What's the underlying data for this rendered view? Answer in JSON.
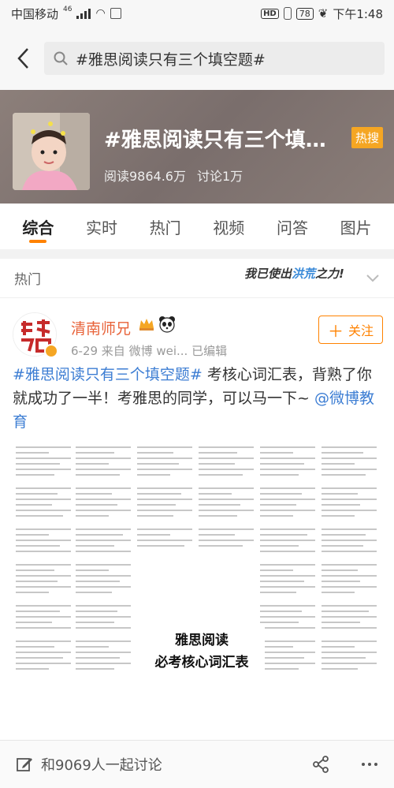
{
  "status": {
    "carrier": "中国移动",
    "net": "46",
    "hd": "HD",
    "battery": "78",
    "time": "下午1:48"
  },
  "search": {
    "query": "#雅思阅读只有三个填空题#"
  },
  "banner": {
    "title": "#雅思阅读只有三个填空题#",
    "hot_badge": "热搜",
    "reads": "阅读9864.6万",
    "discussions": "讨论1万"
  },
  "tabs": [
    "综合",
    "实时",
    "热门",
    "视频",
    "问答",
    "图片"
  ],
  "section": {
    "title": "热门",
    "sticker_pre": "我已使出",
    "sticker_mid": "洪荒",
    "sticker_post": "之力!"
  },
  "post": {
    "author": "清南师兄",
    "meta": "6-29  来自 微博 wei...  已编辑",
    "follow_label": "关注",
    "hashtag": "#雅思阅读只有三个填空题#",
    "text_body": " 考核心词汇表，背熟了你就成功了一半！考雅思的同学，可以马一下~ ",
    "mention": "@微博教育",
    "image_title_line1": "雅思阅读",
    "image_title_line2": "必考核心词汇表"
  },
  "bottom": {
    "comment_prompt": "和9069人一起讨论"
  },
  "colors": {
    "accent": "#ff8200",
    "link": "#3c7dd3",
    "author": "#e8633a",
    "hot_badge": "#f5a623"
  }
}
